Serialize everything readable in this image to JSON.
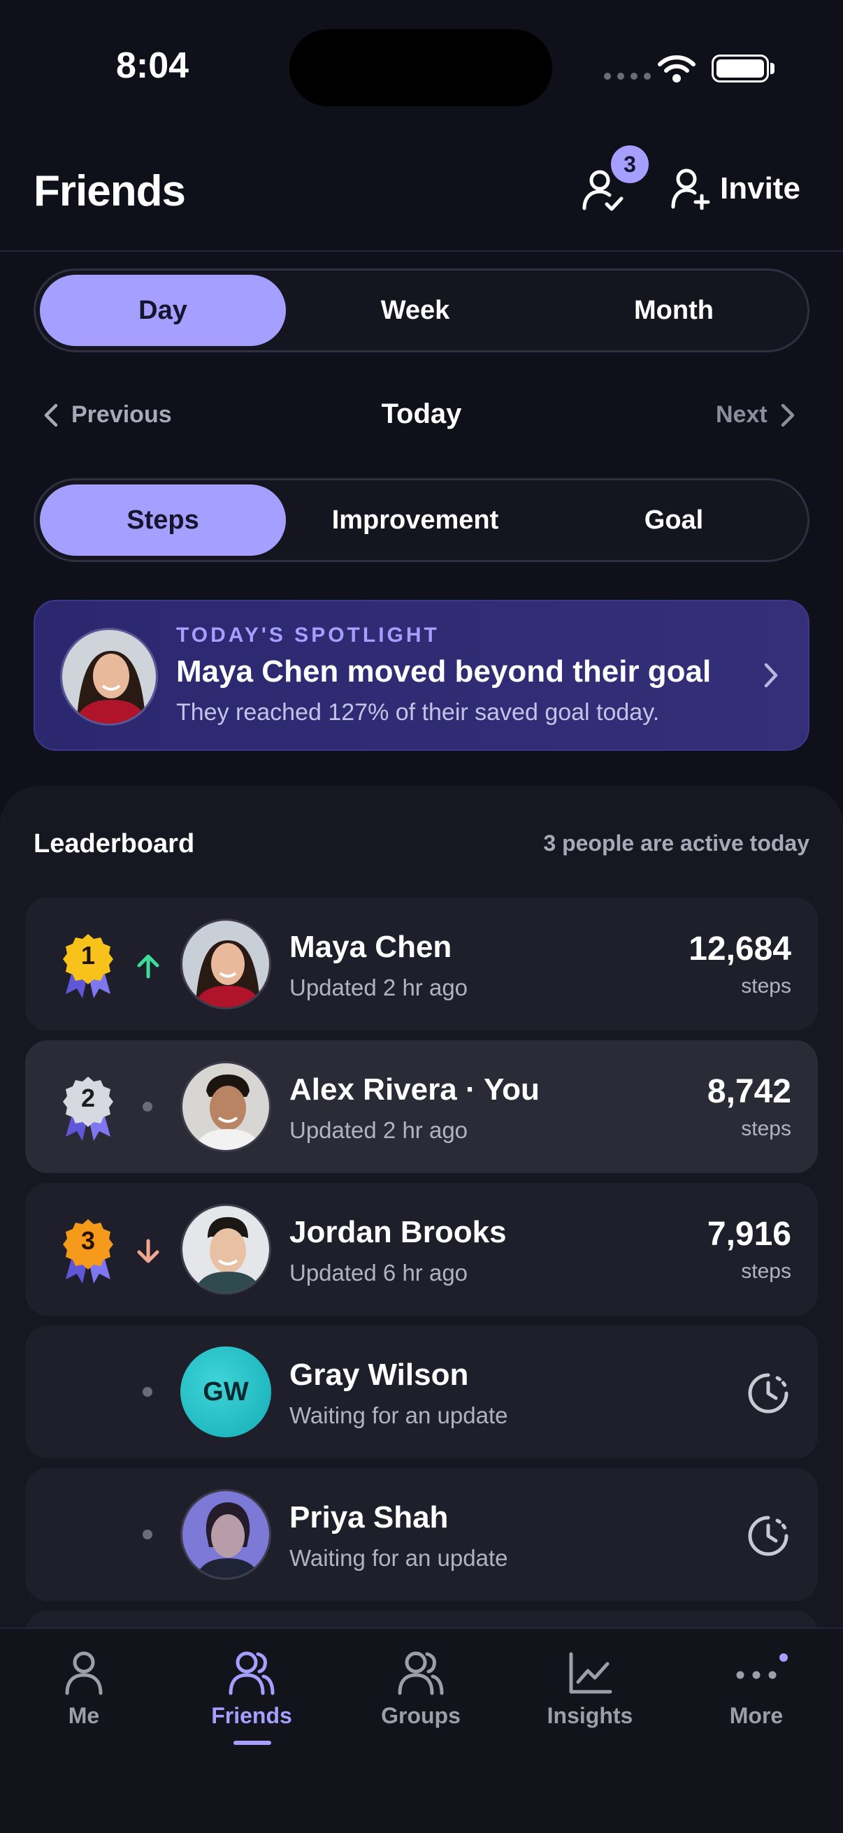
{
  "status_bar": {
    "time": "8:04"
  },
  "header": {
    "title": "Friends",
    "requests_badge": "3",
    "invite_label": "Invite"
  },
  "period_tabs": [
    {
      "label": "Day",
      "active": true
    },
    {
      "label": "Week",
      "active": false
    },
    {
      "label": "Month",
      "active": false
    }
  ],
  "date_nav": {
    "previous": "Previous",
    "current": "Today",
    "next": "Next"
  },
  "metric_tabs": [
    {
      "label": "Steps",
      "active": true
    },
    {
      "label": "Improvement",
      "active": false
    },
    {
      "label": "Goal",
      "active": false
    }
  ],
  "spotlight": {
    "eyebrow": "TODAY'S SPOTLIGHT",
    "title": "Maya Chen moved beyond their goal",
    "subtitle": "They reached 127% of their saved goal today."
  },
  "leaderboard": {
    "title": "Leaderboard",
    "active_text": "3 people are active today",
    "rows": [
      {
        "rank": "1",
        "trend": "up",
        "name": "Maya Chen",
        "updated": "Updated 2 hr ago",
        "steps": "12,684",
        "unit": "steps"
      },
      {
        "rank": "2",
        "trend": "same",
        "name": "Alex Rivera · You",
        "updated": "Updated 2 hr ago",
        "steps": "8,742",
        "unit": "steps"
      },
      {
        "rank": "3",
        "trend": "down",
        "name": "Jordan Brooks",
        "updated": "Updated 6 hr ago",
        "steps": "7,916",
        "unit": "steps"
      },
      {
        "rank": "",
        "trend": "same",
        "name": "Gray Wilson",
        "initials": "GW",
        "updated": "Waiting for an update"
      },
      {
        "rank": "",
        "trend": "same",
        "name": "Priya Shah",
        "updated": "Waiting for an update"
      }
    ]
  },
  "tab_bar": [
    {
      "label": "Me",
      "icon": "person-icon",
      "active": false
    },
    {
      "label": "Friends",
      "icon": "friends-icon",
      "active": true
    },
    {
      "label": "Groups",
      "icon": "groups-icon",
      "active": false
    },
    {
      "label": "Insights",
      "icon": "chart-icon",
      "active": false
    },
    {
      "label": "More",
      "icon": "more-icon",
      "active": false
    }
  ],
  "colors": {
    "background": "#10101a",
    "accent": "#a5a0ff",
    "spotlight": "#2c2870",
    "trend_up": "#3ddc97",
    "trend_down": "#f0a890",
    "gold": "#f7c21a",
    "silver": "#d8d8e0",
    "bronze": "#f59a1a"
  }
}
